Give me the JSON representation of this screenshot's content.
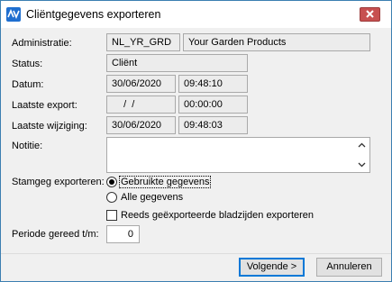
{
  "window": {
    "title": "Cliëntgegevens exporteren",
    "app_icon": "app-logo-icon",
    "close_icon": "close-icon"
  },
  "form": {
    "administratie": {
      "label": "Administratie:",
      "code": "NL_YR_GRD",
      "name": "Your Garden Products"
    },
    "status": {
      "label": "Status:",
      "value": "Cliënt"
    },
    "datum": {
      "label": "Datum:",
      "date": "30/06/2020",
      "time": "09:48:10"
    },
    "laatste_export": {
      "label": "Laatste export:",
      "date": "  /  /",
      "time": "00:00:00"
    },
    "laatste_wijziging": {
      "label": "Laatste wijziging:",
      "date": "30/06/2020",
      "time": "09:48:03"
    },
    "notitie": {
      "label": "Notitie:",
      "value": ""
    },
    "stamgeg": {
      "label": "Stamgeg exporteren:",
      "options": [
        "Gebruikte gegevens",
        "Alle gegevens"
      ],
      "selected": "Gebruikte gegevens"
    },
    "reeds": {
      "label": "Reeds geëxporteerde bladzijden exporteren",
      "checked": false
    },
    "periode": {
      "label": "Periode gereed t/m:",
      "value": "0"
    }
  },
  "buttons": {
    "next": "Volgende >",
    "cancel": "Annuleren"
  }
}
